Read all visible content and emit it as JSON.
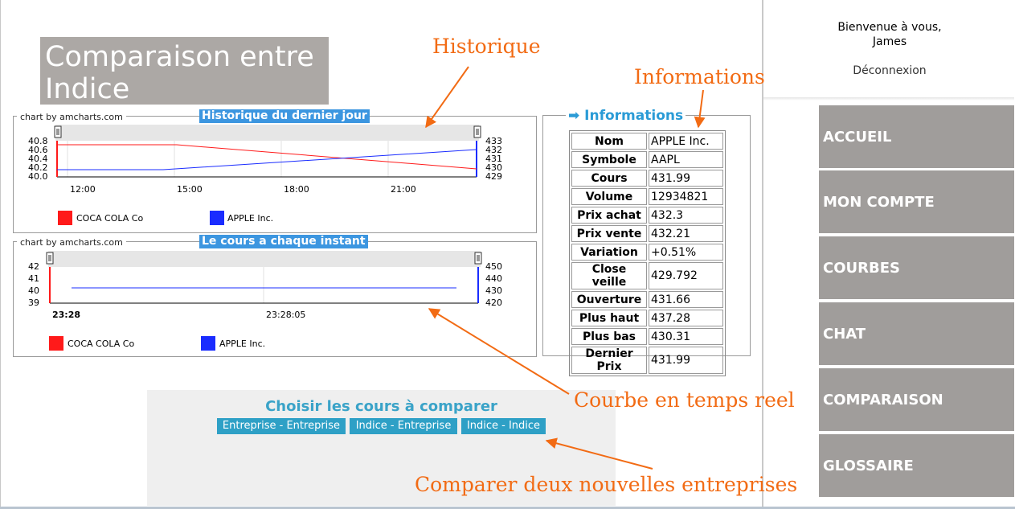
{
  "page_title": "Comparaison entre Indice",
  "chart1": {
    "credit": "chart by amcharts.com",
    "title": "Historique du dernier jour",
    "left_ticks": [
      "40.8",
      "40.6",
      "40.4",
      "40.2",
      "40.0"
    ],
    "right_ticks": [
      "433",
      "432",
      "431",
      "430",
      "429"
    ],
    "x_ticks": [
      "12:00",
      "15:00",
      "18:00",
      "21:00"
    ],
    "legend": [
      "COCA COLA Co",
      "APPLE Inc."
    ]
  },
  "chart2": {
    "credit": "chart by amcharts.com",
    "title": "Le cours a chaque instant",
    "left_ticks": [
      "42",
      "41",
      "40",
      "39"
    ],
    "right_ticks": [
      "450",
      "440",
      "430",
      "420"
    ],
    "x_ticks": [
      "23:28",
      "23:28:05"
    ],
    "legend": [
      "COCA COLA Co",
      "APPLE Inc."
    ]
  },
  "info": {
    "title": "Informations",
    "rows": [
      {
        "k": "Nom",
        "v": "APPLE Inc."
      },
      {
        "k": "Symbole",
        "v": "AAPL"
      },
      {
        "k": "Cours",
        "v": "431.99"
      },
      {
        "k": "Volume",
        "v": "12934821"
      },
      {
        "k": "Prix achat",
        "v": "432.3"
      },
      {
        "k": "Prix vente",
        "v": "432.21"
      },
      {
        "k": "Variation",
        "v": "+0.51%"
      },
      {
        "k": "Close veille",
        "v": "429.792"
      },
      {
        "k": "Ouverture",
        "v": "431.66"
      },
      {
        "k": "Plus haut",
        "v": "437.28"
      },
      {
        "k": "Plus bas",
        "v": "430.31"
      },
      {
        "k": "Dernier Prix",
        "v": "431.99"
      }
    ]
  },
  "compare": {
    "title": "Choisir les cours à comparer",
    "buttons": [
      "Entreprise - Entreprise",
      "Indice - Entreprise",
      "Indice - Indice"
    ]
  },
  "annotations": {
    "historique": "Historique",
    "informations": "Informations",
    "courbe": "Courbe  en  temps  reel",
    "comparer": "Comparer  deux  nouvelles  entreprises"
  },
  "user": {
    "welcome_line1": "Bienvenue à vous,",
    "welcome_line2": "James",
    "logout": "Déconnexion"
  },
  "nav": [
    "ACCUEIL",
    "MON  COMPTE",
    "COURBES",
    "CHAT",
    "COMPARAISON",
    "GLOSSAIRE"
  ],
  "colors": {
    "series1": "#ff1a1a",
    "series2": "#1a2cff",
    "annotation": "#f26b14",
    "nav_bg": "#a09d9b",
    "accent": "#2ea0c6"
  }
}
